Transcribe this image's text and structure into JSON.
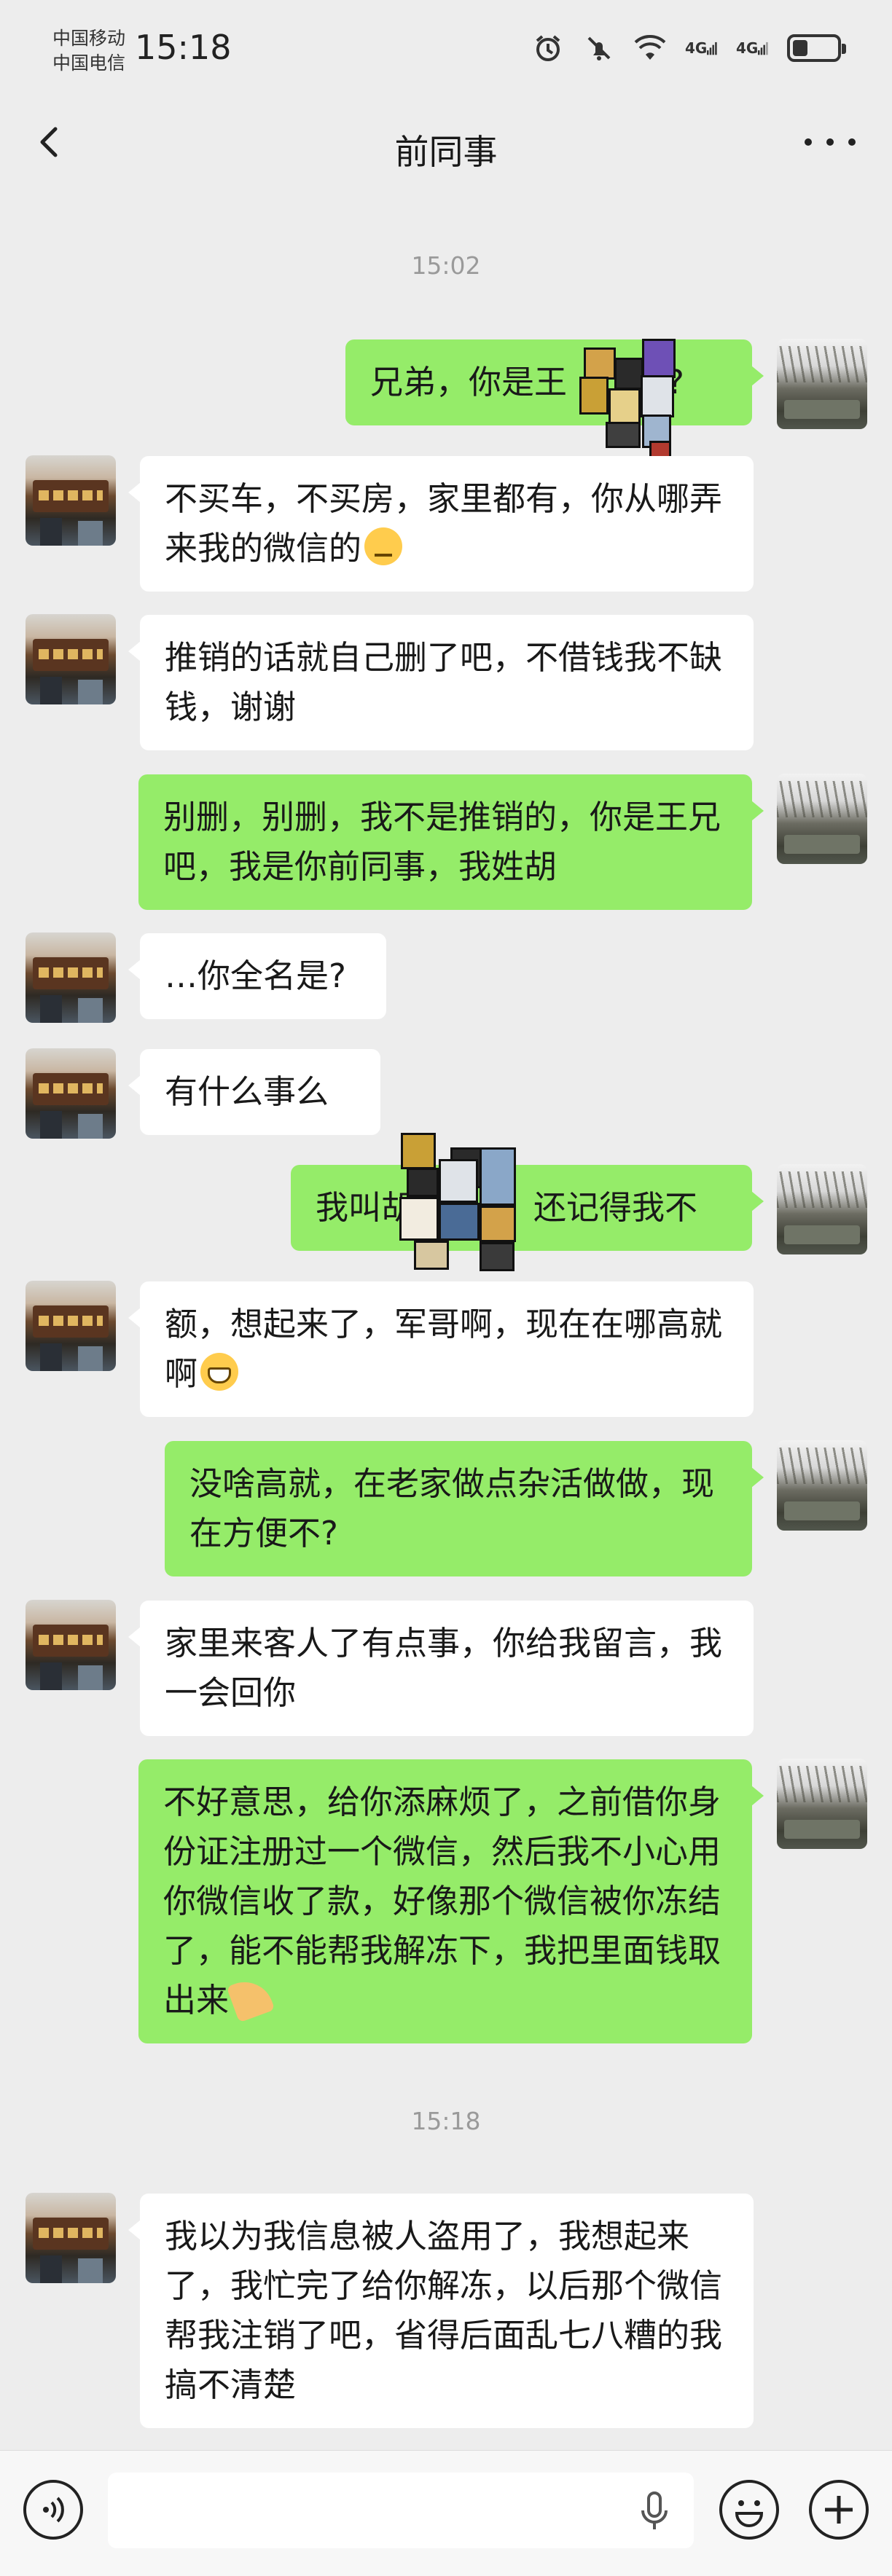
{
  "status_bar": {
    "carrier_1": "中国移动",
    "carrier_2": "中国电信",
    "time": "15:18",
    "net_1": "4G",
    "net_2": "4G",
    "battery_level": 0.35
  },
  "header": {
    "title": "前同事"
  },
  "timestamps": [
    "15:02",
    "15:18"
  ],
  "messages": [
    {
      "from": "me",
      "text": "兄弟，你是王",
      "text_tail": "不?"
    },
    {
      "from": "other",
      "text": "不买车，不买房，家里都有，你从哪弄来我的微信的",
      "emoji": "face-with-rolling-eyes-emoji"
    },
    {
      "from": "other",
      "text": "推销的话就自己删了吧，不借钱我不缺钱，谢谢"
    },
    {
      "from": "me",
      "text": "别删，别删，我不是推销的，你是王兄吧，我是你前同事，我姓胡"
    },
    {
      "from": "other",
      "text": "…你全名是?"
    },
    {
      "from": "other",
      "text": "有什么事么"
    },
    {
      "from": "me",
      "text": "我叫胡",
      "text_tail": "还记得我不"
    },
    {
      "from": "other",
      "text": "额，想起来了，军哥啊，现在在哪高就啊",
      "emoji": "grinning-face-emoji"
    },
    {
      "from": "me",
      "text": "没啥高就，在老家做点杂活做做，现在方便不?"
    },
    {
      "from": "other",
      "text": "家里来客人了有点事，你给我留言，我一会回你"
    },
    {
      "from": "me",
      "text": "不好意思，给你添麻烦了，之前借你身份证注册过一个微信，然后我不小心用你微信收了款，好像那个微信被你冻结了，能不能帮我解冻下，我把里面钱取出来",
      "emoji": "folded-hands-emoji"
    },
    {
      "from": "other",
      "text": "我以为我信息被人盗用了，我想起来了，我忙完了给你解冻，以后那个微信帮我注销了吧，省得后面乱七八糟的我搞不清楚"
    }
  ],
  "input": {
    "value": "",
    "placeholder": ""
  },
  "icons": {
    "back": "back-arrow-icon",
    "more": "more-options-icon",
    "voice": "voice-input-icon",
    "mic": "microphone-icon",
    "emoji": "emoji-icon",
    "plus": "plus-icon"
  },
  "colors": {
    "background": "#ededed",
    "my_bubble": "#95ec69",
    "other_bubble": "#ffffff",
    "timestamp": "#9a9a9a"
  }
}
